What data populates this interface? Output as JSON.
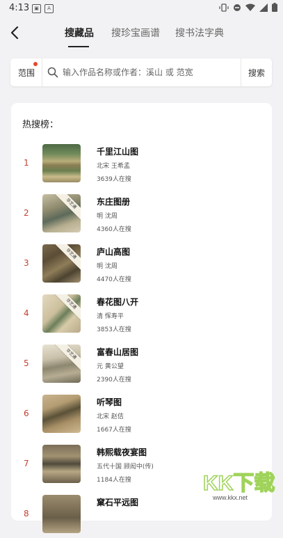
{
  "status": {
    "time": "4:13"
  },
  "tabs": [
    {
      "label": "搜藏品"
    },
    {
      "label": "搜珍宝画谱"
    },
    {
      "label": "搜书法字典"
    }
  ],
  "search": {
    "scope_label": "范围",
    "placeholder": "输入作品名称或作者：溪山 或 范宽",
    "button_label": "搜索"
  },
  "hot": {
    "title": "热搜榜：",
    "items": [
      {
        "rank": "1",
        "title": "千里江山图",
        "meta": "北宋 王希孟",
        "count": "3639人在搜",
        "badge": ""
      },
      {
        "rank": "2",
        "title": "东庄图册",
        "meta": "明 沈周",
        "count": "4360人在搜",
        "badge": "华艺通"
      },
      {
        "rank": "3",
        "title": "庐山高图",
        "meta": "明 沈周",
        "count": "4470人在搜",
        "badge": "华艺通"
      },
      {
        "rank": "4",
        "title": "春花图八开",
        "meta": "清 恽寿平",
        "count": "3853人在搜",
        "badge": "华艺通"
      },
      {
        "rank": "5",
        "title": "富春山居图",
        "meta": "元 黄公望",
        "count": "2390人在搜",
        "badge": "华艺通"
      },
      {
        "rank": "6",
        "title": "听琴图",
        "meta": "北宋 赵佶",
        "count": "1667人在搜",
        "badge": ""
      },
      {
        "rank": "7",
        "title": "韩熙载夜宴图",
        "meta": "五代十国 顾闳中(传)",
        "count": "1184人在搜",
        "badge": ""
      },
      {
        "rank": "8",
        "title": "窠石平远图",
        "meta": "",
        "count": "",
        "badge": ""
      }
    ]
  },
  "watermark": {
    "text": "KK下载",
    "url": "www.kkx.net"
  },
  "colors": {
    "rank": "#c2412f",
    "accent_dot": "#e5482e",
    "background": "#f2f2f4"
  }
}
